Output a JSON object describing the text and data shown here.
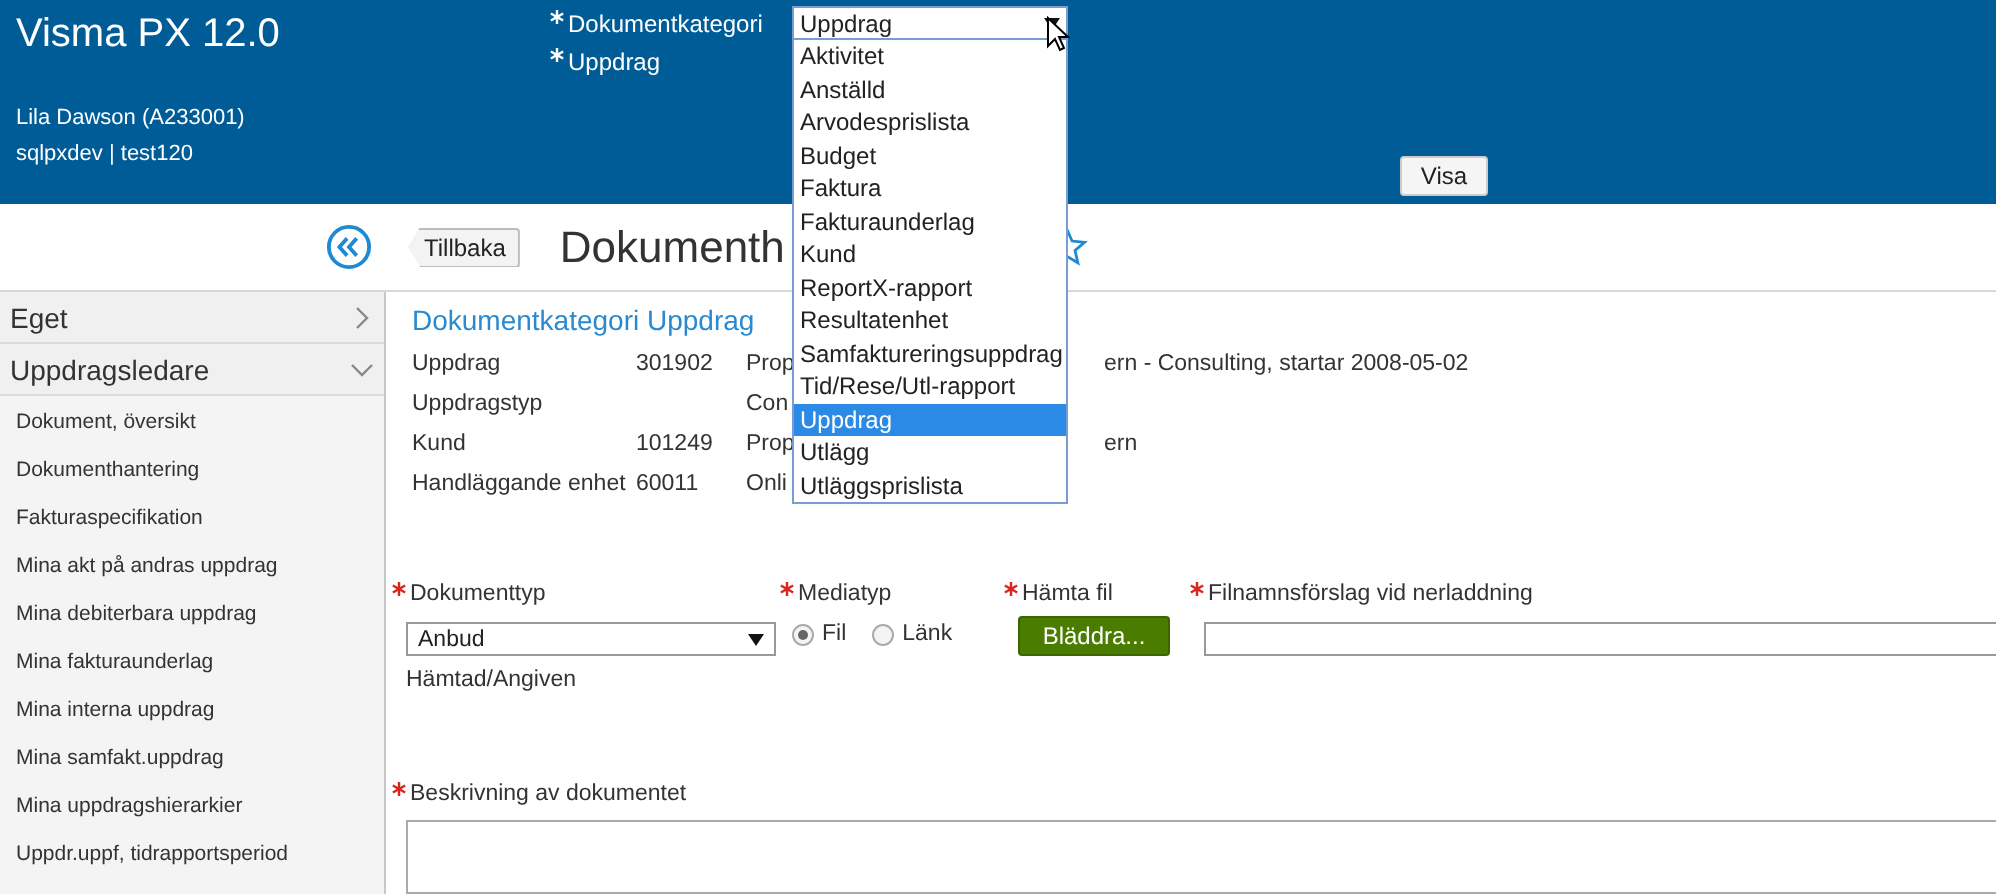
{
  "app_title": "Visma PX 12.0",
  "user": "Lila Dawson (A233001)",
  "database": "sqlpxdev | test120",
  "header_fields": [
    {
      "label": "Dokumentkategori",
      "required": true
    },
    {
      "label": "Uppdrag",
      "required": true
    }
  ],
  "category_select": {
    "value": "Uppdrag",
    "expanded": true,
    "options": [
      {
        "label": "Aktivitet",
        "selected": false
      },
      {
        "label": "Anställd",
        "selected": false
      },
      {
        "label": "Arvodesprislista",
        "selected": false
      },
      {
        "label": "Budget",
        "selected": false
      },
      {
        "label": "Faktura",
        "selected": false
      },
      {
        "label": "Fakturaunderlag",
        "selected": false
      },
      {
        "label": "Kund",
        "selected": false
      },
      {
        "label": "ReportX-rapport",
        "selected": false
      },
      {
        "label": "Resultatenhet",
        "selected": false
      },
      {
        "label": "Samfaktureringsuppdrag",
        "selected": false
      },
      {
        "label": "Tid/Rese/Utl-rapport",
        "selected": false
      },
      {
        "label": "Uppdrag",
        "selected": true
      },
      {
        "label": "Utlägg",
        "selected": false
      },
      {
        "label": "Utläggsprislista",
        "selected": false
      }
    ]
  },
  "show_button": "Visa",
  "back_button": "Tillbaka",
  "page_title": "Dokumenth",
  "sidebar": [
    {
      "label": "Eget",
      "expanded": false
    },
    {
      "label": "Uppdragsledare",
      "expanded": true,
      "children": [
        {
          "label": "Dokument, översikt"
        },
        {
          "label": "Dokumenthantering"
        },
        {
          "label": "Fakturaspecifikation"
        },
        {
          "label": "Mina akt på andras uppdrag"
        },
        {
          "label": "Mina debiterbara uppdrag"
        },
        {
          "label": "Mina fakturaunderlag"
        },
        {
          "label": "Mina interna uppdrag"
        },
        {
          "label": "Mina samfakt.uppdrag"
        },
        {
          "label": "Mina uppdragshierarkier"
        },
        {
          "label": "Uppdr.uppf, tidrapportsperiod"
        }
      ]
    }
  ],
  "section_title": "Dokumentkategori Uppdrag",
  "info_rows": [
    {
      "label": "Uppdrag",
      "column_2": "301902",
      "column_3": "Prop",
      "column_4": "ern - Consulting, startar 2008-05-02"
    },
    {
      "label": "Uppdragstyp",
      "column_3": "Con"
    },
    {
      "label": "Kund",
      "column_2": "101249",
      "column_3": "Prop",
      "column_4": "ern"
    },
    {
      "label": "Handläggande enhet",
      "column_2": "60011",
      "column_3": "Onli"
    }
  ],
  "form": [
    {
      "kind": "select",
      "label": "Dokumenttyp",
      "required": true,
      "value": "Anbud",
      "note": "Hämtad/Angiven"
    },
    {
      "kind": "radio",
      "label": "Mediatyp",
      "required": true,
      "options": [
        {
          "label": "Fil",
          "selected": true
        },
        {
          "label": "Länk",
          "selected": false
        }
      ]
    },
    {
      "kind": "file",
      "label": "Hämta fil",
      "required": true,
      "button": "Bläddra..."
    },
    {
      "kind": "text",
      "label": "Filnamnsförslag vid nerladdning",
      "required": true
    }
  ],
  "description": {
    "label": "Beskrivning av dokumentet",
    "required": true
  }
}
